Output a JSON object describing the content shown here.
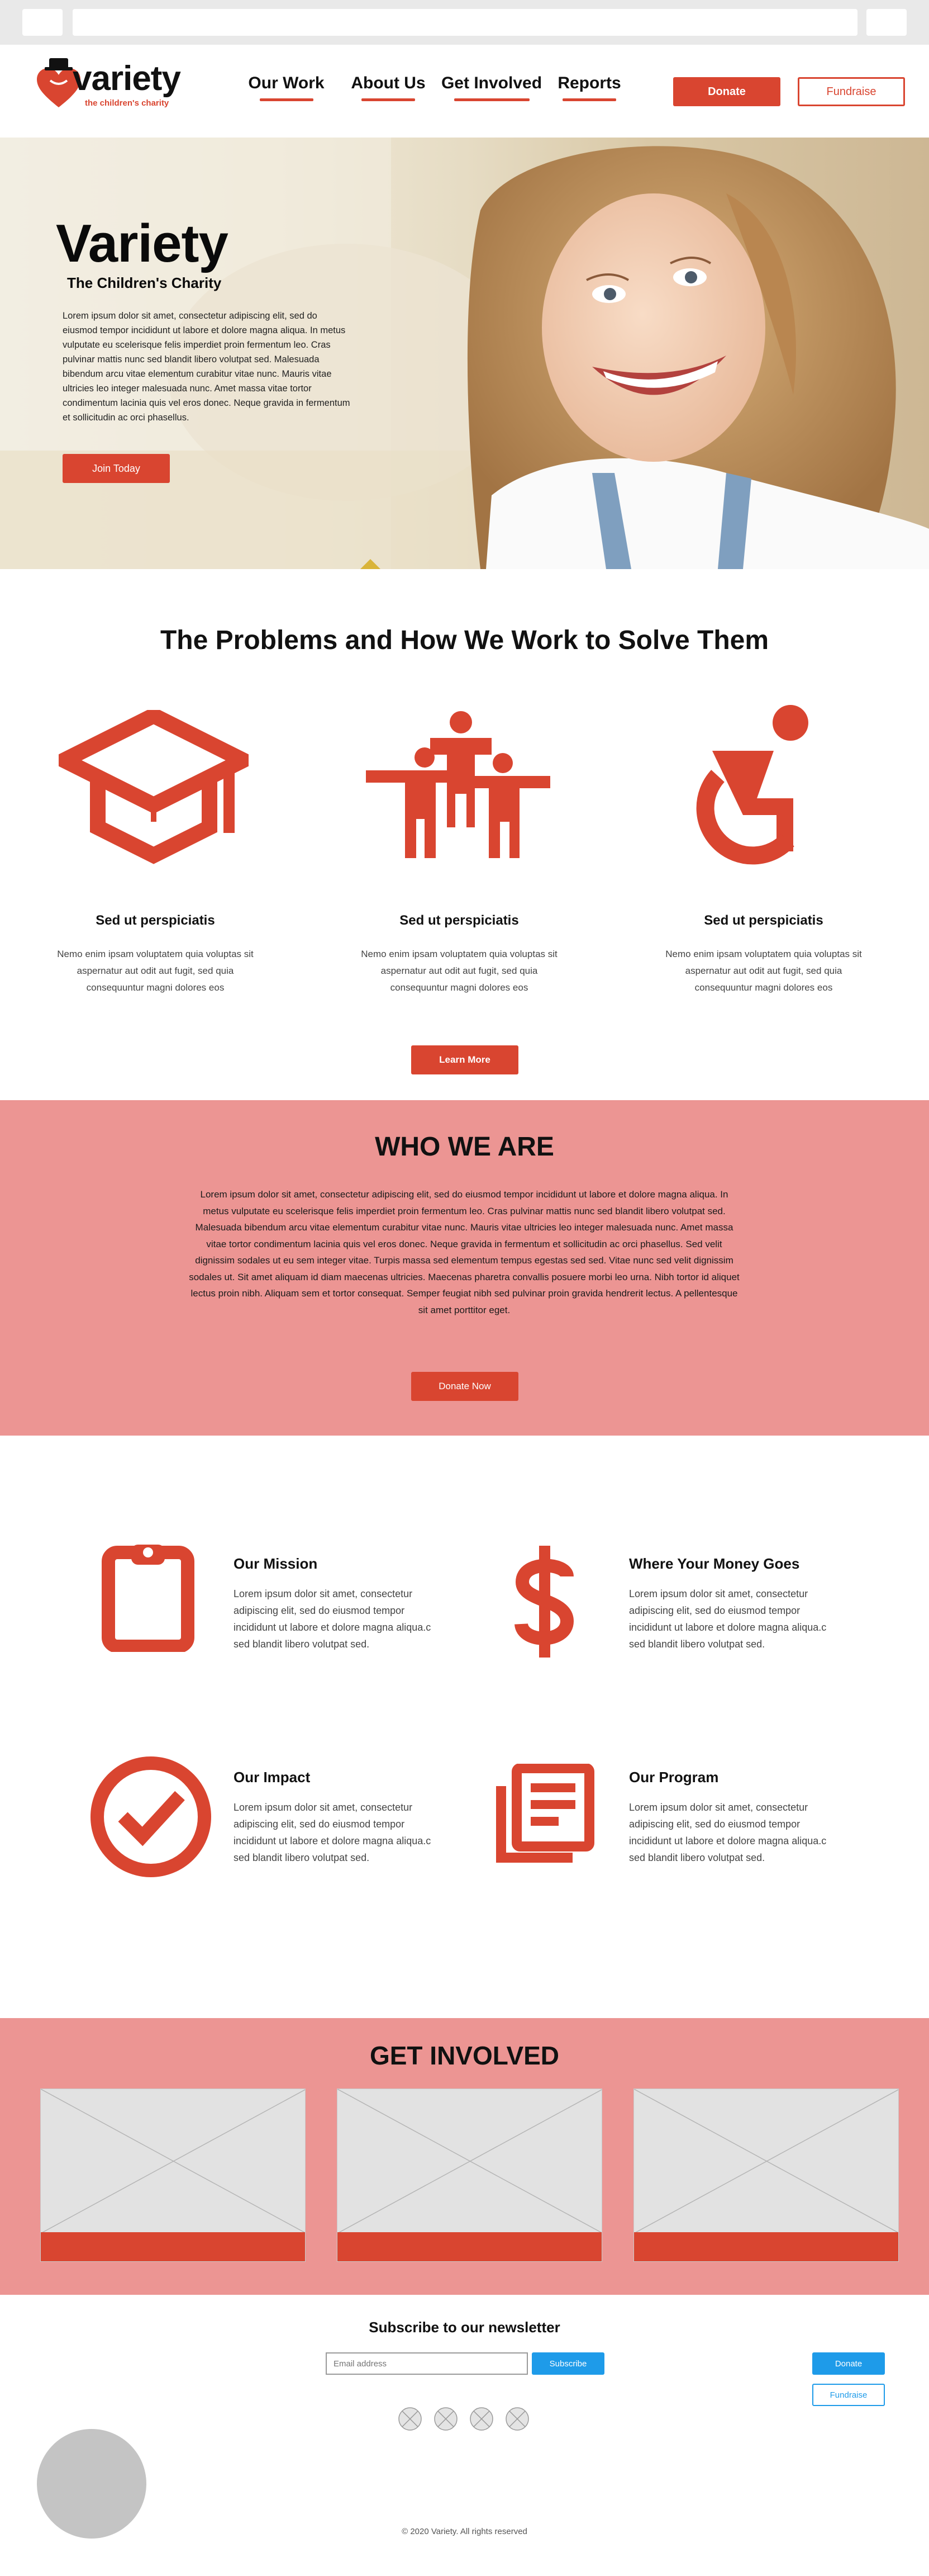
{
  "header": {
    "logo_word": "variety",
    "logo_tagline": "the children's charity",
    "nav": [
      {
        "label": "Our Work"
      },
      {
        "label": "About Us"
      },
      {
        "label": "Get Involved"
      },
      {
        "label": "Reports"
      }
    ],
    "donate_label": "Donate",
    "fundraise_label": "Fundraise"
  },
  "hero": {
    "title": "Variety",
    "subtitle": "The Children's Charity",
    "body": "Lorem ipsum dolor sit amet, consectetur adipiscing elit, sed do eiusmod tempor incididunt ut labore et dolore magna aliqua. In metus vulputate eu scelerisque felis imperdiet proin fermentum leo. Cras pulvinar mattis nunc sed blandit libero volutpat sed. Malesuada bibendum arcu vitae elementum curabitur vitae nunc. Mauris vitae ultricies leo integer malesuada nunc. Amet massa vitae tortor condimentum lacinia quis vel eros donec. Neque gravida in fermentum et sollicitudin ac orci phasellus.",
    "cta_label": "Join Today"
  },
  "problems": {
    "title": "The Problems and How We Work to Solve Them",
    "cards": [
      {
        "icon": "graduation-cap-icon",
        "title": "Sed ut perspiciatis",
        "body": "Nemo enim ipsam voluptatem quia voluptas sit aspernatur aut odit aut fugit, sed quia consequuntur magni dolores eos"
      },
      {
        "icon": "people-group-icon",
        "title": "Sed ut perspiciatis",
        "body": "Nemo enim ipsam voluptatem quia voluptas sit aspernatur aut odit aut fugit, sed quia consequuntur magni dolores eos"
      },
      {
        "icon": "wheelchair-icon",
        "title": "Sed ut perspiciatis",
        "body": "Nemo enim ipsam voluptatem quia voluptas sit aspernatur aut odit aut fugit, sed quia consequuntur magni dolores eos"
      }
    ],
    "cta_label": "Learn More"
  },
  "who": {
    "title": "WHO WE ARE",
    "body": "Lorem ipsum dolor sit amet, consectetur adipiscing elit, sed do eiusmod tempor incididunt ut labore et dolore magna aliqua. In metus vulputate eu scelerisque felis imperdiet proin fermentum leo. Cras pulvinar mattis nunc sed blandit libero volutpat sed. Malesuada bibendum arcu vitae elementum curabitur vitae nunc. Mauris vitae ultricies leo integer malesuada nunc. Amet massa vitae tortor condimentum lacinia quis vel eros donec. Neque gravida in fermentum et sollicitudin ac orci phasellus. Sed velit dignissim sodales ut eu sem integer vitae. Turpis massa sed elementum tempus egestas sed sed. Vitae nunc sed velit dignissim sodales ut. Sit amet aliquam id diam maecenas ultricies. Maecenas pharetra convallis posuere morbi leo urna. Nibh tortor id aliquet lectus proin nibh. Aliquam sem et tortor consequat. Semper feugiat nibh sed pulvinar proin gravida hendrerit lectus. A pellentesque sit amet porttitor eget.",
    "cta_label": "Donate Now"
  },
  "mission": {
    "items": [
      {
        "icon": "clipboard-icon",
        "title": "Our Mission",
        "body": "Lorem ipsum dolor sit amet, consectetur adipiscing elit, sed do eiusmod tempor incididunt ut labore et dolore magna aliqua.c sed blandit libero volutpat sed."
      },
      {
        "icon": "dollar-icon",
        "title": "Where Your Money Goes",
        "body": "Lorem ipsum dolor sit amet, consectetur adipiscing elit, sed do eiusmod tempor incididunt ut labore et dolore magna aliqua.c sed blandit libero volutpat sed."
      },
      {
        "icon": "checkmark-circle-icon",
        "title": "Our Impact",
        "body": "Lorem ipsum dolor sit amet, consectetur adipiscing elit, sed do eiusmod tempor incididunt ut labore et dolore magna aliqua.c sed blandit libero volutpat sed."
      },
      {
        "icon": "documents-icon",
        "title": "Our Program",
        "body": "Lorem ipsum dolor sit amet, consectetur adipiscing elit, sed do eiusmod tempor incididunt ut labore et dolore magna aliqua.c sed blandit libero volutpat sed."
      }
    ]
  },
  "get_involved": {
    "title": "GET INVOLVED"
  },
  "footer": {
    "newsletter_title": "Subscribe to our newsletter",
    "email_placeholder": "Email address",
    "subscribe_label": "Subscribe",
    "donate_label": "Donate",
    "fundraise_label": "Fundraise",
    "copyright": "© 2020 Variety. All rights reserved"
  },
  "colors": {
    "accent": "#d94530",
    "pink_band": "#ec9593",
    "blue": "#1e9be9"
  }
}
